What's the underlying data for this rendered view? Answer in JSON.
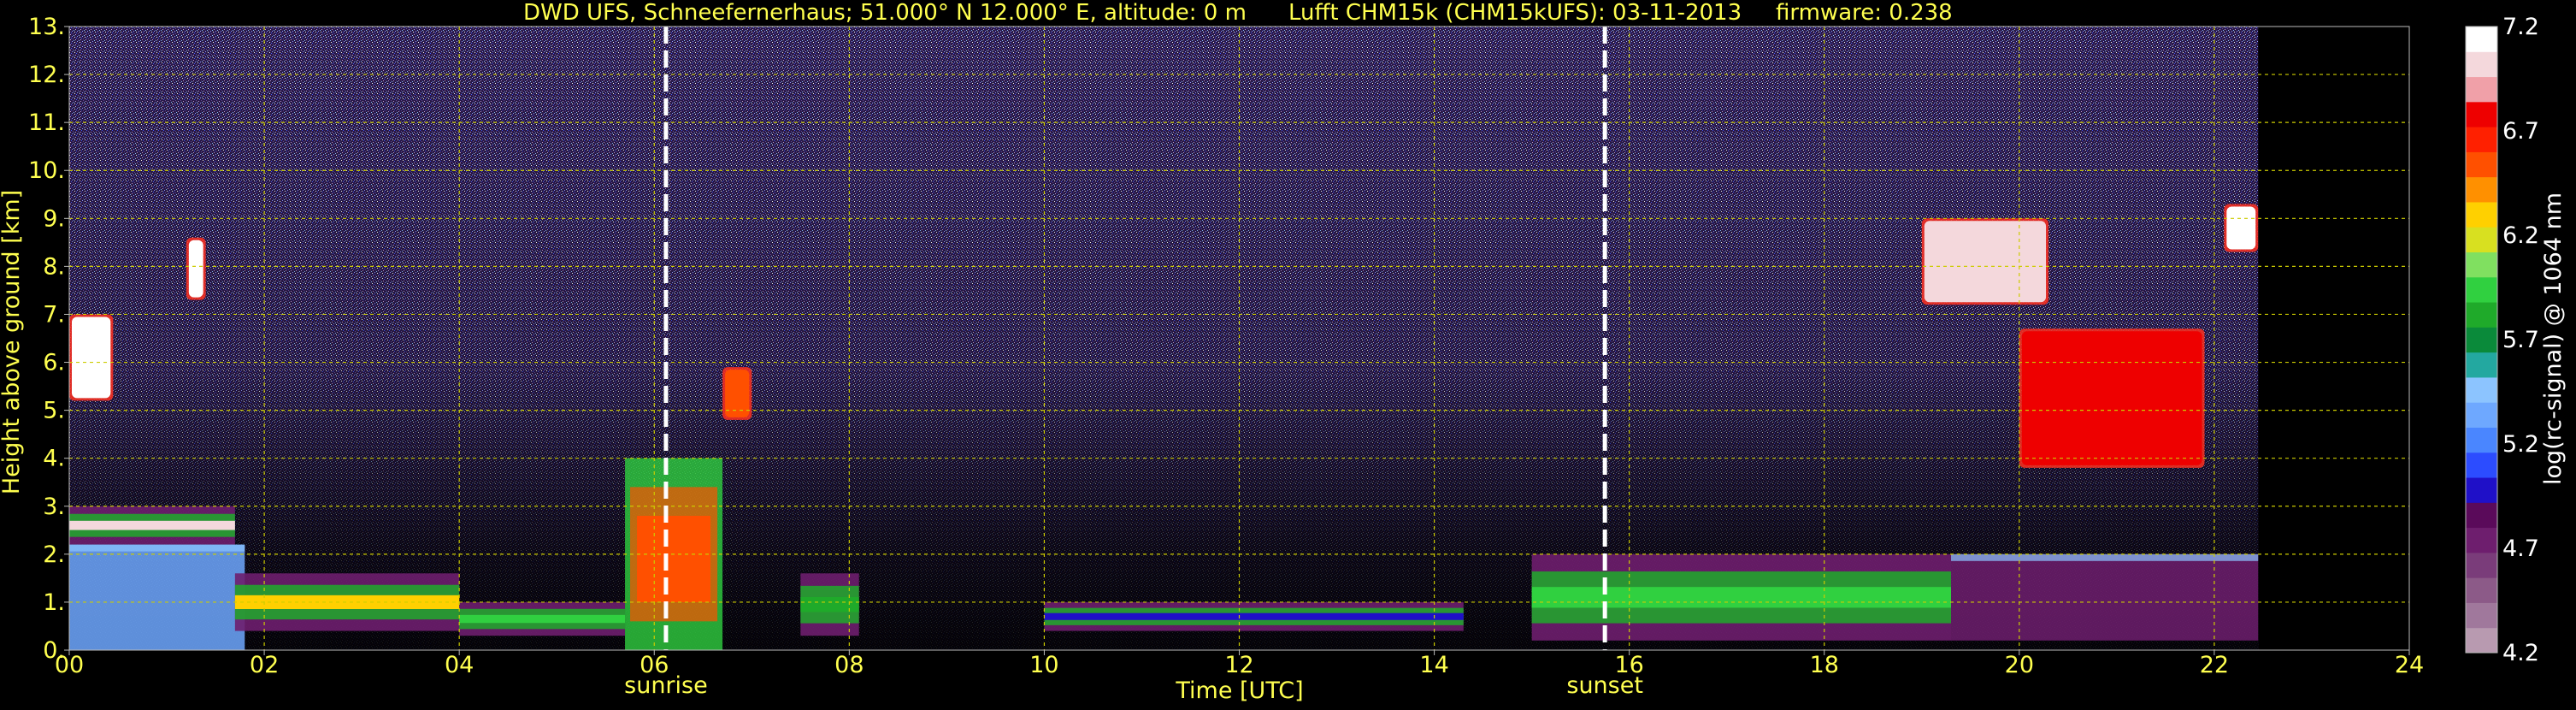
{
  "header": {
    "site": "DWD UFS, Schneefernerhaus; 51.000° N 12.000° E, altitude: 0 m",
    "instrument": "Lufft CHM15k (CHM15kUFS): 03-11-2013",
    "firmware": "firmware: 0.238"
  },
  "colors": {
    "text": "#ffff4f",
    "grid": "#cccc00",
    "background": "#000000",
    "event_line": "#ffffff"
  },
  "chart_data": {
    "type": "heatmap",
    "title": "DWD UFS, Schneefernerhaus; 51.000° N 12.000° E, altitude: 0 m    Lufft CHM15k (CHM15kUFS): 03-11-2013    firmware: 0.238",
    "xlabel": "Time [UTC]",
    "ylabel": "Height above ground [km]",
    "xlim": [
      0,
      24
    ],
    "ylim": [
      0,
      13
    ],
    "x_ticks": [
      "00",
      "02",
      "04",
      "06",
      "08",
      "10",
      "12",
      "14",
      "16",
      "18",
      "20",
      "22",
      "24"
    ],
    "y_ticks": [
      "0.",
      "1.",
      "2.",
      "3.",
      "4.",
      "5.",
      "6.",
      "7.",
      "8.",
      "9.",
      "10.",
      "11.",
      "12.",
      "13."
    ],
    "grid": true,
    "data_end_hour": 22.45,
    "colorbar": {
      "label": "log(rc-signal) @ 1064 nm",
      "range": [
        4.2,
        7.2
      ],
      "ticks": [
        "4.2",
        "4.7",
        "5.2",
        "5.7",
        "6.2",
        "6.7",
        "7.2"
      ],
      "colors": [
        "#b89ab0",
        "#a0789c",
        "#8c5a88",
        "#7a3c7a",
        "#6e1e6e",
        "#5a0a5a",
        "#1f10c8",
        "#2c4cff",
        "#4a86ff",
        "#6ea8ff",
        "#8cc4ff",
        "#23a8a0",
        "#0a8a3a",
        "#1faa2a",
        "#30d040",
        "#80e060",
        "#d8e020",
        "#ffd000",
        "#ff9000",
        "#ff5000",
        "#ff2000",
        "#ee0000",
        "#f0a0a8",
        "#f4d8dc",
        "#ffffff"
      ]
    },
    "events": [
      {
        "label": "sunrise",
        "hour": 6.12
      },
      {
        "label": "sunset",
        "hour": 15.75
      }
    ],
    "features": [
      {
        "kind": "cloud",
        "t_start": 0.0,
        "t_end": 0.45,
        "h_min": 5.2,
        "h_max": 7.0,
        "level": 7.2
      },
      {
        "kind": "cloud",
        "t_start": 1.2,
        "t_end": 1.4,
        "h_min": 7.3,
        "h_max": 8.6,
        "level": 7.2
      },
      {
        "kind": "layer",
        "t_start": 0.0,
        "t_end": 1.7,
        "h_min": 2.2,
        "h_max": 3.0,
        "level": 7.0
      },
      {
        "kind": "boundary",
        "t_start": 0.0,
        "t_end": 1.8,
        "h_min": 0.0,
        "h_max": 2.2,
        "level": 5.3
      },
      {
        "kind": "layer",
        "t_start": 1.7,
        "t_end": 4.0,
        "h_min": 0.4,
        "h_max": 1.6,
        "level": 6.3
      },
      {
        "kind": "layer",
        "t_start": 4.0,
        "t_end": 5.7,
        "h_min": 0.3,
        "h_max": 1.0,
        "level": 5.9
      },
      {
        "kind": "plume",
        "t_start": 5.7,
        "t_end": 6.7,
        "h_min": 0.0,
        "h_max": 4.0,
        "level": 6.6
      },
      {
        "kind": "cloud",
        "t_start": 6.7,
        "t_end": 7.0,
        "h_min": 4.8,
        "h_max": 5.9,
        "level": 6.6
      },
      {
        "kind": "layer",
        "t_start": 7.5,
        "t_end": 8.1,
        "h_min": 0.3,
        "h_max": 1.6,
        "level": 5.8
      },
      {
        "kind": "layer",
        "t_start": 10.0,
        "t_end": 14.3,
        "h_min": 0.4,
        "h_max": 1.0,
        "level": 5.0
      },
      {
        "kind": "layer",
        "t_start": 15.0,
        "t_end": 19.3,
        "h_min": 0.2,
        "h_max": 2.0,
        "level": 5.9
      },
      {
        "kind": "boundary",
        "t_start": 19.3,
        "t_end": 22.45,
        "h_min": 0.2,
        "h_max": 2.0,
        "level": 4.8
      },
      {
        "kind": "cloud",
        "t_start": 19.0,
        "t_end": 20.3,
        "h_min": 7.2,
        "h_max": 9.0,
        "level": 7.0
      },
      {
        "kind": "cloud",
        "t_start": 20.0,
        "t_end": 21.9,
        "h_min": 3.8,
        "h_max": 6.7,
        "level": 6.8
      },
      {
        "kind": "cloud",
        "t_start": 22.1,
        "t_end": 22.45,
        "h_min": 8.3,
        "h_max": 9.3,
        "level": 7.2
      }
    ]
  }
}
